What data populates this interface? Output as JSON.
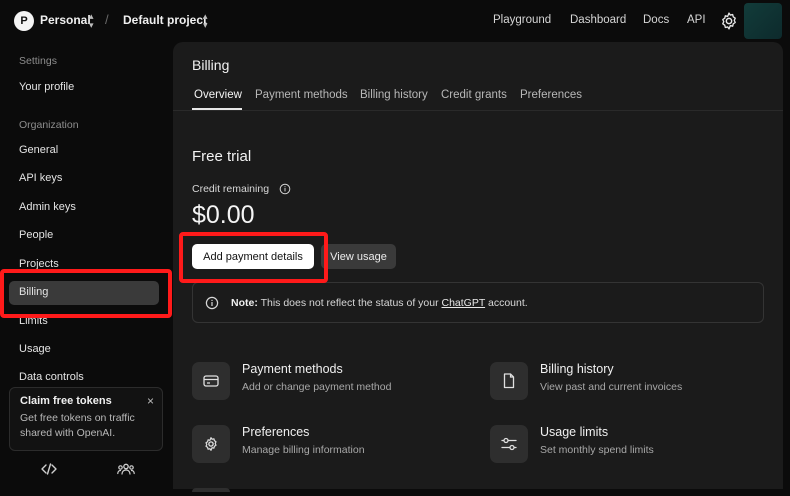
{
  "topbar": {
    "org_initial": "P",
    "org_name": "Personal",
    "separator": "/",
    "project_name": "Default project",
    "links": [
      "Playground",
      "Dashboard",
      "Docs",
      "API"
    ]
  },
  "sidebar": {
    "settings_heading": "Settings",
    "profile": "Your profile",
    "organization_heading": "Organization",
    "items": [
      "General",
      "API keys",
      "Admin keys",
      "People",
      "Projects",
      "Billing",
      "Limits",
      "Usage",
      "Data controls"
    ],
    "active_item": "Billing",
    "claim": {
      "title": "Claim free tokens",
      "body": "Get free tokens on traffic shared with OpenAI.",
      "close": "×"
    }
  },
  "billing": {
    "title": "Billing",
    "tabs": [
      "Overview",
      "Payment methods",
      "Billing history",
      "Credit grants",
      "Preferences"
    ],
    "active_tab": "Overview",
    "plan_title": "Free trial",
    "credit_label": "Credit remaining",
    "credit_amount": "$0.00",
    "primary_button": "Add payment details",
    "secondary_button": "View usage",
    "note": {
      "prefix": "Note:",
      "text_before": " This does not reflect the status of your ",
      "link": "ChatGPT",
      "text_after": " account."
    },
    "cards": [
      {
        "title": "Payment methods",
        "desc": "Add or change payment method",
        "icon": "credit-card-icon"
      },
      {
        "title": "Billing history",
        "desc": "View past and current invoices",
        "icon": "document-icon"
      },
      {
        "title": "Preferences",
        "desc": "Manage billing information",
        "icon": "gear-icon"
      },
      {
        "title": "Usage limits",
        "desc": "Set monthly spend limits",
        "icon": "sliders-icon"
      }
    ]
  },
  "colors": {
    "background": "#0b0b0b",
    "panel": "#1b1b1b",
    "highlight": "#ff1a1a",
    "primary_button": "#ffffff"
  }
}
